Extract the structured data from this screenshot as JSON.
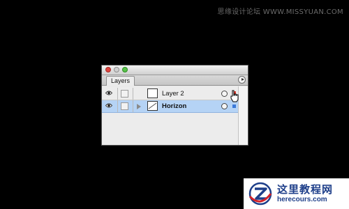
{
  "watermark_top": "思缘设计论坛 WWW.MISSYUAN.COM",
  "panel": {
    "tab_label": "Layers",
    "layers": [
      {
        "name": "Layer 2",
        "selected": false,
        "visible": true,
        "indicator_color": "#d93a2e"
      },
      {
        "name": "Horizon",
        "selected": true,
        "visible": true,
        "indicator_color": "#3b79d8"
      }
    ],
    "selected_row_color": "#b5d3f5"
  },
  "watermark_bottom": {
    "cn_title": "这里教程网",
    "url": "herecours.com"
  }
}
